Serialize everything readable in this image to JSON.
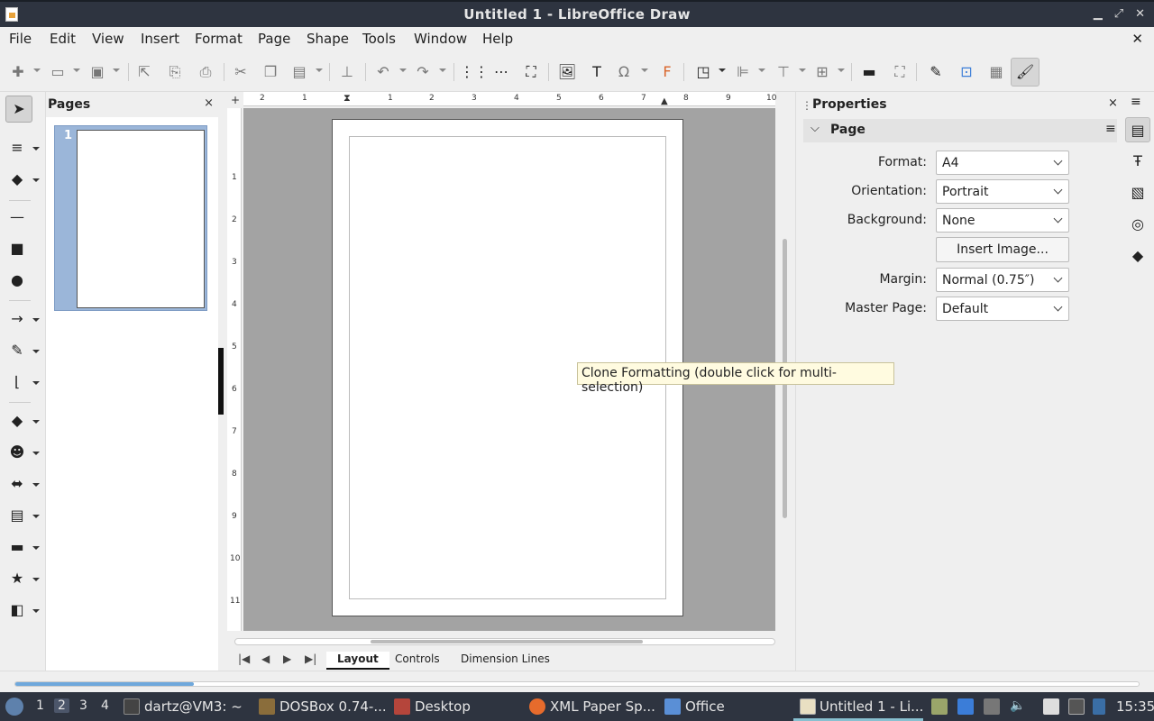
{
  "window": {
    "title": "Untitled 1 - LibreOffice Draw",
    "minimize": "▁",
    "restore": "⤢",
    "close": "✕"
  },
  "menu": {
    "items": [
      "File",
      "Edit",
      "View",
      "Insert",
      "Format",
      "Page",
      "Shape",
      "Tools",
      "Window",
      "Help"
    ],
    "close_doc": "✕"
  },
  "pages_panel": {
    "title": "Pages",
    "close": "×",
    "thumbnails": [
      {
        "number": "1"
      }
    ]
  },
  "sidebar": {
    "title": "Properties",
    "close": "×",
    "menu": "≡",
    "section": {
      "title": "Page",
      "menu": "≡"
    },
    "fields": {
      "format": {
        "label": "Format:",
        "value": "A4"
      },
      "orientation": {
        "label": "Orientation:",
        "value": "Portrait"
      },
      "background": {
        "label": "Background:",
        "value": "None"
      },
      "insert_image": {
        "label": "Insert Image..."
      },
      "margin": {
        "label": "Margin:",
        "value": "Normal (0.75″)"
      },
      "master_page": {
        "label": "Master Page:",
        "value": "Default"
      }
    }
  },
  "ruler": {
    "h_ticks": [
      "2",
      "1",
      "1",
      "1",
      "2",
      "3",
      "4",
      "5",
      "6",
      "7",
      "8",
      "9",
      "10"
    ],
    "v_ticks": [
      "1",
      "2",
      "3",
      "4",
      "5",
      "6",
      "7",
      "8",
      "9",
      "10",
      "11"
    ]
  },
  "tooltip": "Clone Formatting (double click for multi-selection)",
  "tabs": {
    "items": [
      "Layout",
      "Controls",
      "Dimension Lines"
    ],
    "active": "Layout"
  },
  "taskbar": {
    "workspaces": [
      "1",
      "2",
      "3",
      "4"
    ],
    "current_workspace": "2",
    "tasks": [
      {
        "label": "dartz@VM3: ~",
        "icon": "terminal-icon"
      },
      {
        "label": "DOSBox 0.74-...",
        "icon": "dosbox-icon"
      },
      {
        "label": "Desktop",
        "icon": "desktop-icon"
      },
      {
        "label": "XML Paper Sp...",
        "icon": "firefox-icon"
      },
      {
        "label": "Office",
        "icon": "folder-icon"
      },
      {
        "label": "Untitled 1 - Li...",
        "icon": "libreoffice-draw-icon"
      }
    ],
    "clock": "15:35"
  },
  "colors": {
    "titlebar": "#2e3440",
    "selection": "#9bb6d9",
    "canvas_bg": "#a3a3a3",
    "tooltip_bg": "#fffbe0"
  }
}
